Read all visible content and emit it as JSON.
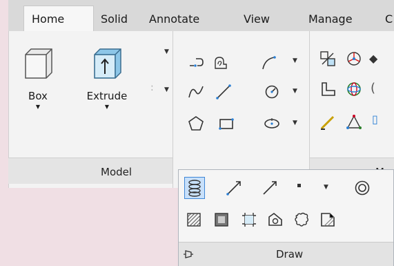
{
  "tabs": [
    {
      "label": "Home"
    },
    {
      "label": "Solid"
    },
    {
      "label": "Annotate"
    },
    {
      "label": "View"
    },
    {
      "label": "Manage"
    }
  ],
  "modeling": {
    "box_label": "Box",
    "extrude_label": "Extrude",
    "panel_title": "Model"
  },
  "right_panel_title_partial": "Mo",
  "draw_panel": {
    "title": "Draw"
  },
  "colors": {
    "accent_blue": "#3e86d6",
    "highlight_fill": "#c8e0fa",
    "ribbon_bg": "#f3f3f3",
    "tabbar_bg": "#d9d9d9"
  },
  "icons": [
    "box-icon",
    "extrude-icon",
    "polyline-icon",
    "region-icon",
    "arc-icon",
    "spline-icon",
    "line-icon",
    "circle-icon",
    "polygon-icon",
    "rectangle-icon",
    "ellipse-icon",
    "helix-icon",
    "ray-icon",
    "xline-icon",
    "point-icon",
    "donut-icon",
    "hatch-icon",
    "gradient-icon",
    "boundary-icon",
    "region-alt-icon",
    "revision-cloud-icon",
    "wipeout-icon",
    "pin-icon"
  ]
}
